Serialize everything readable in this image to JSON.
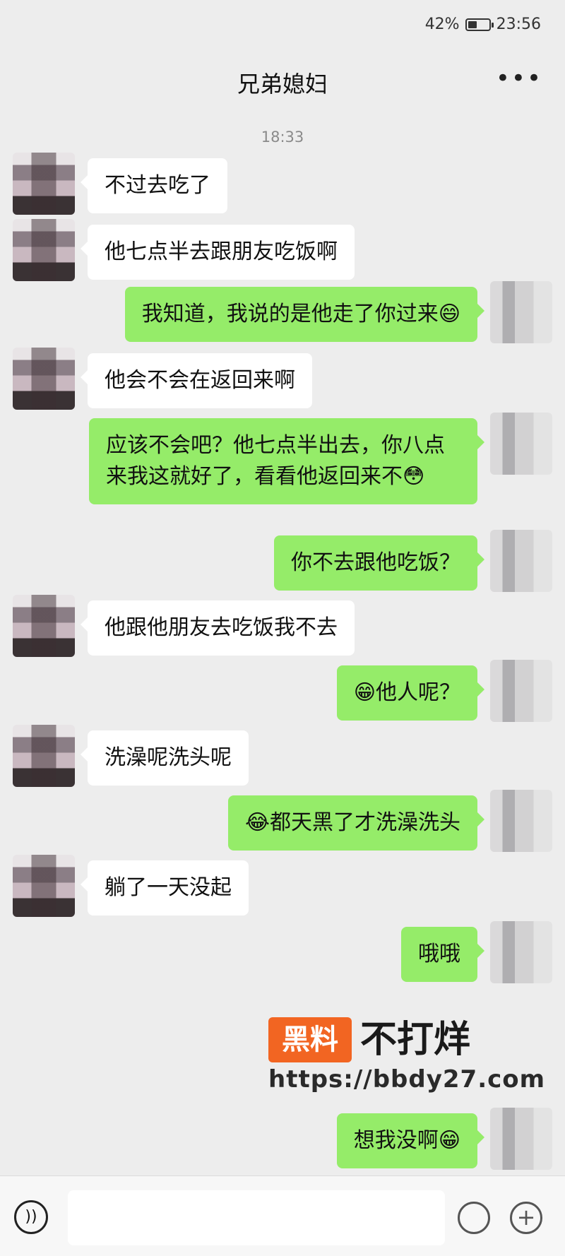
{
  "status_bar": {
    "battery": "42%",
    "time": "23:56",
    "battery_level": 0.42
  },
  "header": {
    "title": "兄弟媳妇",
    "more_icon": "more-horizontal-icon"
  },
  "chat": {
    "timestamp": "18:33",
    "messages": [
      {
        "side": "in",
        "text": "不过去吃了"
      },
      {
        "side": "in",
        "text": "他七点半去跟朋友吃饭啊"
      },
      {
        "side": "out",
        "text": "我知道，我说的是他走了你过来😄"
      },
      {
        "side": "in",
        "text": "他会不会在返回来啊"
      },
      {
        "side": "out",
        "text": "应该不会吧？他七点半出去，你八点来我这就好了，看看他返回来不😳"
      },
      {
        "side": "out",
        "text": "你不去跟他吃饭？"
      },
      {
        "side": "in",
        "text": "他跟他朋友去吃饭我不去"
      },
      {
        "side": "out",
        "text": "😁他人呢？"
      },
      {
        "side": "in",
        "text": "洗澡呢洗头呢"
      },
      {
        "side": "out",
        "text": "😂都天黑了才洗澡洗头"
      },
      {
        "side": "in",
        "text": "躺了一天没起"
      },
      {
        "side": "out",
        "text": "哦哦"
      },
      {
        "side": "out",
        "text": "想我没啊😁"
      }
    ]
  },
  "watermark": {
    "brand": "黑料",
    "slogan": "不打烊",
    "url": "https://bbdy27.com"
  },
  "composer": {
    "voice_icon": "voice-icon",
    "emoji_icon": "emoji-icon",
    "plus_icon": "plus-icon",
    "placeholder": ""
  }
}
